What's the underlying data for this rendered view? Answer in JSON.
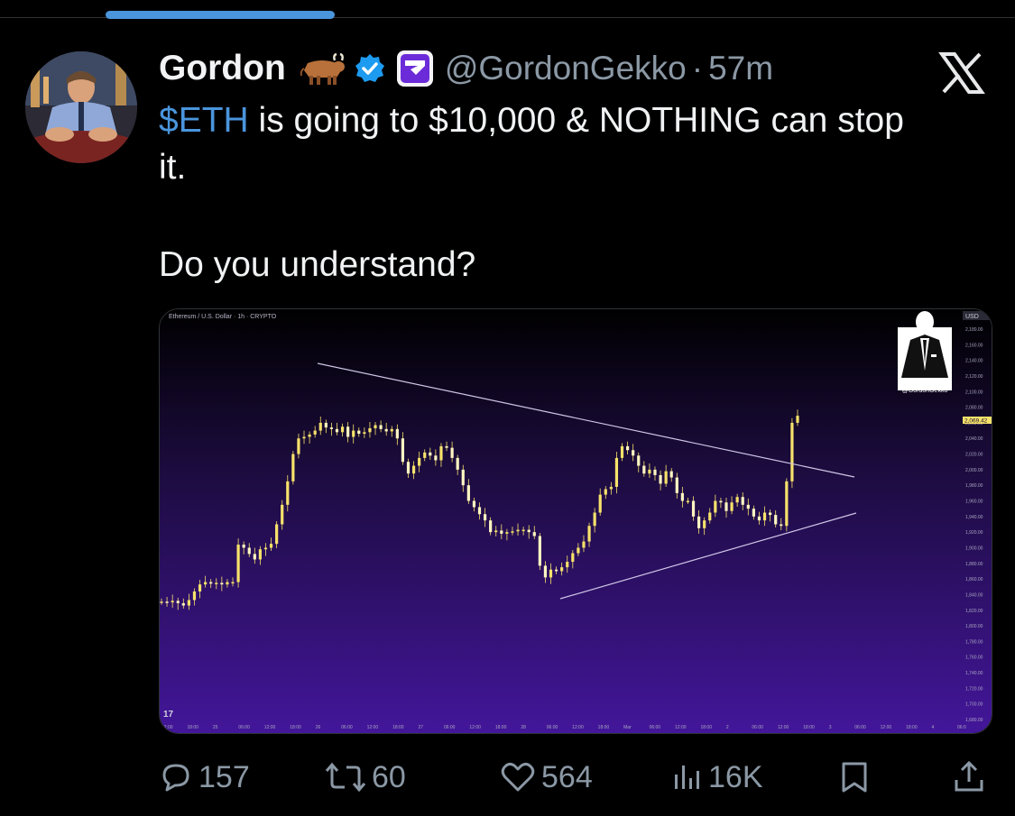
{
  "tweet": {
    "author_name": "Gordon",
    "handle": "@GordonGekko",
    "separator": "·",
    "time": "57m",
    "cashtag": "$ETH",
    "text_line1_rest": " is going to $10,000 & NOTHING can stop",
    "text_line2": "it.",
    "text_line3": "Do you understand?"
  },
  "icons": {
    "author_emoji": "ox-emoji",
    "verified": "verified-checkmark-icon",
    "affiliate": "affiliate-badge-icon",
    "platform": "x-logo-icon"
  },
  "colors": {
    "accent": "#4a95dc",
    "muted": "#8b98a5",
    "candle": "#f7e26b"
  },
  "actions": {
    "replies": "157",
    "reposts": "60",
    "likes": "564",
    "views": "16K"
  },
  "chart_data": {
    "type": "candlestick",
    "title": "Ethereum / U.S. Dollar · 1h · CRYPTO",
    "watermark": "@GordonGekko",
    "currency": "USD",
    "current_price": "2,069.42",
    "y_ticks": [
      "2,180.00",
      "2,160.00",
      "2,140.00",
      "2,120.00",
      "2,100.00",
      "2,080.00",
      "2,060.00",
      "2,040.00",
      "2,020.00",
      "2,000.00",
      "1,980.00",
      "1,960.00",
      "1,940.00",
      "1,920.00",
      "1,900.00",
      "1,880.00",
      "1,860.00",
      "1,840.00",
      "1,820.00",
      "1,800.00",
      "1,780.00",
      "1,760.00",
      "1,740.00",
      "1,720.00",
      "1,700.00",
      "1,680.00"
    ],
    "x_ticks": [
      "12:00",
      "18:00",
      "25",
      "06:00",
      "12:00",
      "18:00",
      "26",
      "06:00",
      "12:00",
      "18:00",
      "27",
      "06:00",
      "12:00",
      "18:00",
      "28",
      "06:00",
      "12:00",
      "18:00",
      "Mar",
      "06:00",
      "12:00",
      "18:00",
      "2",
      "06:00",
      "12:00",
      "18:00",
      "3",
      "06:00",
      "12:00",
      "18:00",
      "4",
      "06:0"
    ],
    "ylim": [
      1680,
      2180
    ],
    "close_series": [
      1831,
      1830,
      1832,
      1829,
      1826,
      1833,
      1844,
      1853,
      1856,
      1854,
      1855,
      1853,
      1856,
      1856,
      1904,
      1900,
      1892,
      1885,
      1898,
      1900,
      1905,
      1930,
      1955,
      1985,
      2020,
      2040,
      2042,
      2045,
      2050,
      2060,
      2054,
      2052,
      2048,
      2055,
      2042,
      2050,
      2046,
      2048,
      2053,
      2057,
      2052,
      2049,
      2052,
      2040,
      2010,
      1995,
      2005,
      2015,
      2022,
      2018,
      2012,
      2030,
      2028,
      2015,
      2000,
      1980,
      1960,
      1952,
      1943,
      1935,
      1920,
      1922,
      1918,
      1920,
      1921,
      1923,
      1923,
      1920,
      1915,
      1877,
      1862,
      1872,
      1870,
      1875,
      1882,
      1893,
      1900,
      1908,
      1928,
      1945,
      1968,
      1975,
      1978,
      2015,
      2030,
      2025,
      2018,
      2005,
      1995,
      2000,
      1993,
      1982,
      1998,
      1990,
      1970,
      1960,
      1960,
      1940,
      1925,
      1935,
      1945,
      1960,
      1958,
      1947,
      1958,
      1965,
      1955,
      1950,
      1940,
      1935,
      1945,
      1942,
      1930,
      1928,
      1985,
      2060,
      2069
    ]
  }
}
